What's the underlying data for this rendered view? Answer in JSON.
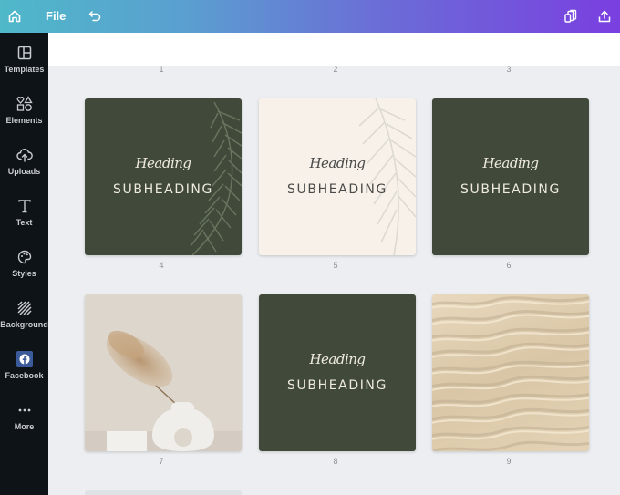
{
  "topbar": {
    "home_icon": "home-icon",
    "file_label": "File",
    "undo_icon": "undo-icon",
    "resize_icon": "copy-pages-icon",
    "share_icon": "share-upload-icon"
  },
  "sidebar": {
    "items": [
      {
        "label": "Templates",
        "icon": "templates-icon"
      },
      {
        "label": "Elements",
        "icon": "elements-icon"
      },
      {
        "label": "Uploads",
        "icon": "upload-cloud-icon"
      },
      {
        "label": "Text",
        "icon": "text-icon"
      },
      {
        "label": "Styles",
        "icon": "palette-icon"
      },
      {
        "label": "Background",
        "icon": "background-stripes-icon"
      },
      {
        "label": "Facebook",
        "icon": "facebook-icon"
      },
      {
        "label": "More",
        "icon": "more-dots-icon"
      }
    ]
  },
  "pages": {
    "numbers_top_row": [
      "1",
      "2",
      "3"
    ],
    "cards": [
      {
        "number": "4",
        "heading": "Heading",
        "subheading": "SUBHEADING",
        "style": "dark",
        "decoration": "palm-leaf"
      },
      {
        "number": "5",
        "heading": "Heading",
        "subheading": "SUBHEADING",
        "style": "light",
        "decoration": "palm-shadow"
      },
      {
        "number": "6",
        "heading": "Heading",
        "subheading": "SUBHEADING",
        "style": "dark",
        "decoration": "none"
      },
      {
        "number": "7",
        "style": "photo",
        "photo": "pampas grass in white ring vase"
      },
      {
        "number": "8",
        "heading": "Heading",
        "subheading": "SUBHEADING",
        "style": "dark",
        "decoration": "none"
      },
      {
        "number": "9",
        "style": "photo",
        "photo": "sand ripples texture"
      }
    ]
  },
  "colors": {
    "dark_green": "#414a3a",
    "cream": "#f7f1ea",
    "sidebar_bg": "#0e1318",
    "canvas_bg": "#eceef1"
  }
}
